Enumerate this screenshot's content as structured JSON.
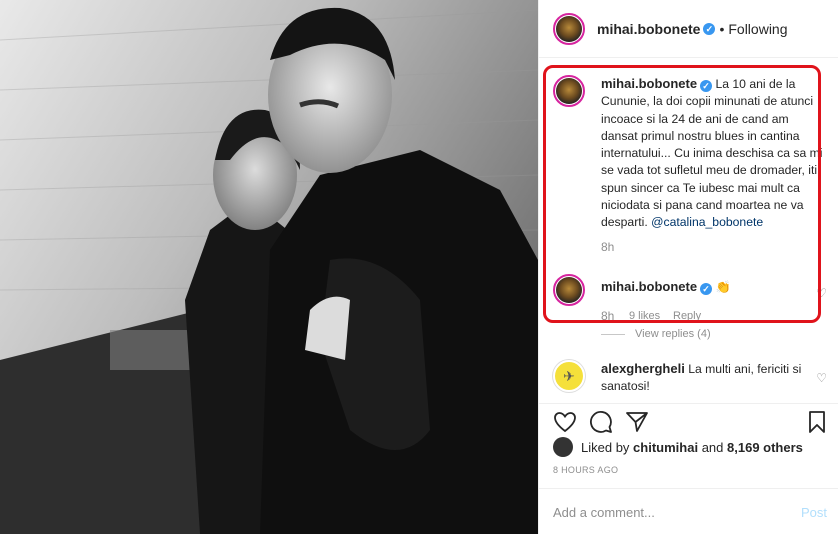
{
  "header": {
    "username": "mihai.bobonete",
    "separator": "•",
    "follow_status": "Following"
  },
  "caption": {
    "username": "mihai.bobonete",
    "text": "La 10 ani de la Cununie, la doi copii minunati de atunci incoace si la 24 de ani de cand am dansat primul nostru blues in cantina internatului... Cu inima deschisa ca sa mi se vada tot sufletul meu de dromader, iti spun sincer ca Te iubesc mai mult ca niciodata si pana cand moartea ne va desparti.",
    "mention": "@catalina_bobonete",
    "time": "8h"
  },
  "comment1": {
    "username": "mihai.bobonete",
    "emoji": "👏",
    "time": "8h",
    "likes": "9 likes",
    "reply": "Reply",
    "view_replies": "View replies (4)"
  },
  "comment2": {
    "username": "alexghergheli",
    "text": "La multi ani, fericiti si sanatosi!"
  },
  "likes": {
    "prefix": "Liked by",
    "user": "chitumihai",
    "and": "and",
    "others": "8,169 others"
  },
  "timestamp": "8 HOURS AGO",
  "add_comment": {
    "placeholder": "Add a comment...",
    "post_label": "Post"
  },
  "colors": {
    "highlight_border": "#e0131b",
    "link": "#003569",
    "verified": "#3897f0",
    "post_disabled": "#b2dffc"
  },
  "icons": [
    "verified-badge-icon",
    "heart-icon",
    "comment-icon",
    "share-icon",
    "bookmark-icon"
  ]
}
